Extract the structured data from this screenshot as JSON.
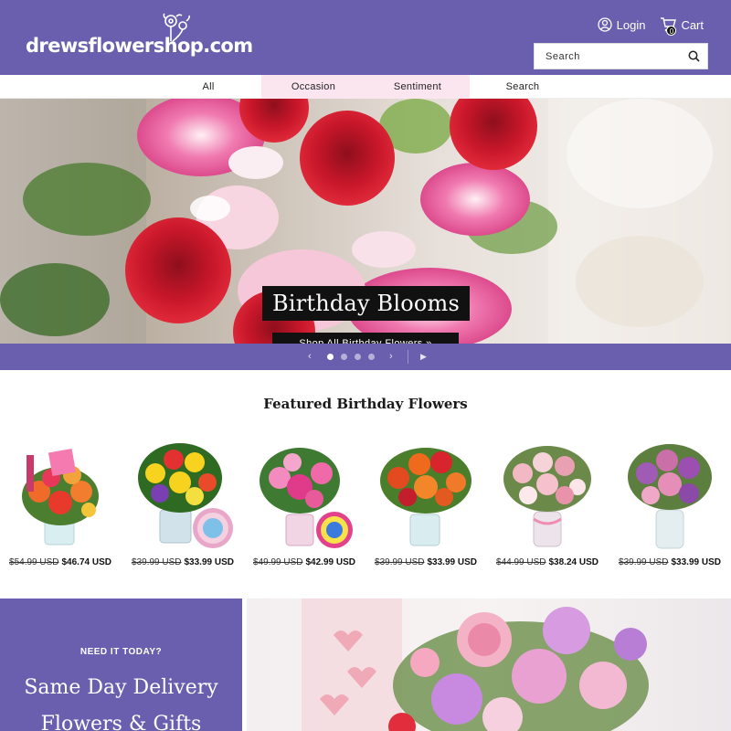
{
  "header": {
    "logo_text": "drewsflowershop.com",
    "login_label": "Login",
    "cart_label": "Cart",
    "cart_count": "0",
    "search_placeholder": "Search"
  },
  "nav": {
    "items": [
      {
        "label": "All"
      },
      {
        "label": "Occasion"
      },
      {
        "label": "Sentiment"
      },
      {
        "label": "Search"
      }
    ]
  },
  "hero": {
    "title": "Birthday Blooms",
    "cta": "Shop All Birthday Flowers »",
    "prev": "‹",
    "next": "›",
    "play": "▶",
    "slides": 4,
    "active_slide": 1
  },
  "featured": {
    "title": "Featured Birthday Flowers",
    "products": [
      {
        "old_price": "$54.99 USD",
        "new_price": "$46.74 USD"
      },
      {
        "old_price": "$39.99 USD",
        "new_price": "$33.99 USD"
      },
      {
        "old_price": "$49.99 USD",
        "new_price": "$42.99 USD"
      },
      {
        "old_price": "$39.99 USD",
        "new_price": "$33.99 USD"
      },
      {
        "old_price": "$44.99 USD",
        "new_price": "$38.24 USD"
      },
      {
        "old_price": "$39.99 USD",
        "new_price": "$33.99 USD"
      }
    ]
  },
  "promo": {
    "kicker": "NEED IT TODAY?",
    "headline_1": "Same Day Delivery",
    "headline_2": "Flowers & Gifts"
  },
  "colors": {
    "brand_purple": "#6a5fae",
    "nav_highlight": "#fbe6ef",
    "black": "#111111"
  }
}
